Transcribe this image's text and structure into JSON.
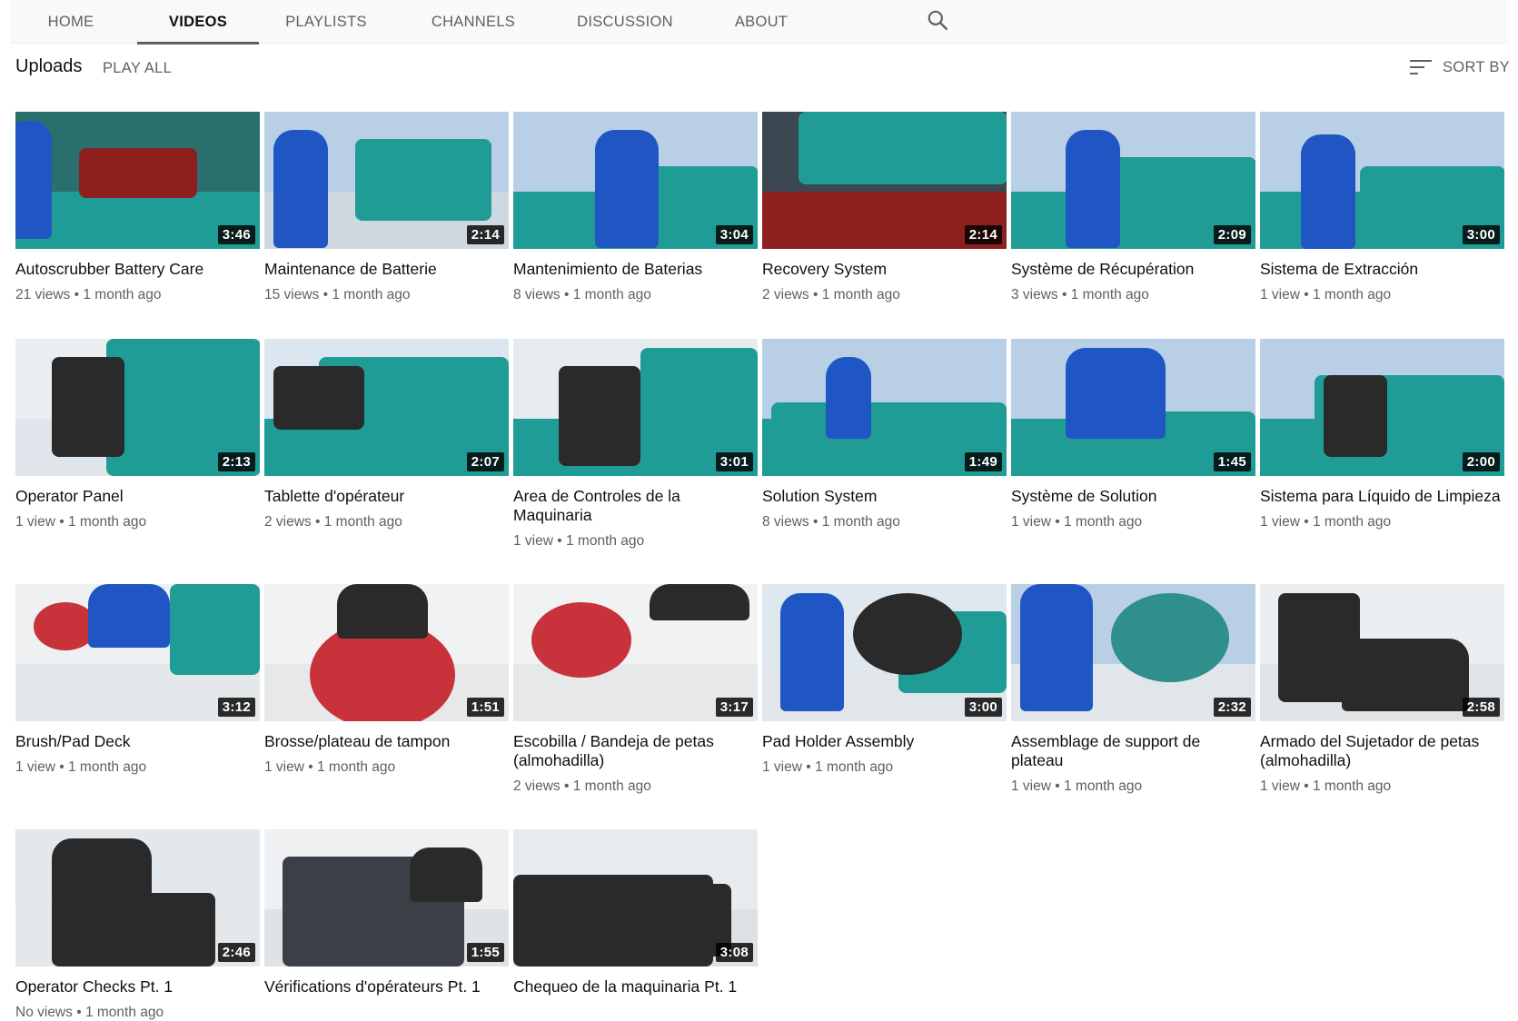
{
  "nav": {
    "tabs": [
      {
        "label": "HOME"
      },
      {
        "label": "VIDEOS"
      },
      {
        "label": "PLAYLISTS"
      },
      {
        "label": "CHANNELS"
      },
      {
        "label": "DISCUSSION"
      },
      {
        "label": "ABOUT"
      }
    ],
    "active_tab": "VIDEOS",
    "search_icon": "search-icon"
  },
  "section": {
    "title": "Uploads",
    "play_all": "PLAY ALL",
    "sort_label": "SORT BY",
    "sort_icon": "sort-icon"
  },
  "videos": [
    {
      "title": "Autoscrubber Battery Care",
      "duration": "3:46",
      "views": "21 views",
      "age": "1 month ago"
    },
    {
      "title": "Maintenance de Batterie",
      "duration": "2:14",
      "views": "15 views",
      "age": "1 month ago"
    },
    {
      "title": "Mantenimiento de Baterias",
      "duration": "3:04",
      "views": "8 views",
      "age": "1 month ago"
    },
    {
      "title": "Recovery System",
      "duration": "2:14",
      "views": "2 views",
      "age": "1 month ago"
    },
    {
      "title": "Système de Récupération",
      "duration": "2:09",
      "views": "3 views",
      "age": "1 month ago"
    },
    {
      "title": "Sistema de Extracción",
      "duration": "3:00",
      "views": "1 view",
      "age": "1 month ago"
    },
    {
      "title": "Operator Panel",
      "duration": "2:13",
      "views": "1 view",
      "age": "1 month ago"
    },
    {
      "title": "Tablette d'opérateur",
      "duration": "2:07",
      "views": "2 views",
      "age": "1 month ago"
    },
    {
      "title": "Area de Controles de la Maquinaria",
      "duration": "3:01",
      "views": "1 view",
      "age": "1 month ago"
    },
    {
      "title": "Solution System",
      "duration": "1:49",
      "views": "8 views",
      "age": "1 month ago"
    },
    {
      "title": "Système de Solution",
      "duration": "1:45",
      "views": "1 view",
      "age": "1 month ago"
    },
    {
      "title": "Sistema para Líquido de Limpieza",
      "duration": "2:00",
      "views": "1 view",
      "age": "1 month ago"
    },
    {
      "title": "Brush/Pad Deck",
      "duration": "3:12",
      "views": "1 view",
      "age": "1 month ago"
    },
    {
      "title": "Brosse/plateau de tampon",
      "duration": "1:51",
      "views": "1 view",
      "age": "1 month ago"
    },
    {
      "title": "Escobilla / Bandeja de petas (almohadilla)",
      "duration": "3:17",
      "views": "2 views",
      "age": "1 month ago"
    },
    {
      "title": "Pad Holder Assembly",
      "duration": "3:00",
      "views": "1 view",
      "age": "1 month ago"
    },
    {
      "title": "Assemblage de support de plateau",
      "duration": "2:32",
      "views": "1 view",
      "age": "1 month ago"
    },
    {
      "title": "Armado del Sujetador de petas (almohadilla)",
      "duration": "2:58",
      "views": "1 view",
      "age": "1 month ago"
    },
    {
      "title": "Operator Checks Pt. 1",
      "duration": "2:46",
      "views": "No views",
      "age": "1 month ago"
    },
    {
      "title": "Vérifications d'opérateurs Pt. 1",
      "duration": "1:55",
      "views": "",
      "age": ""
    },
    {
      "title": "Chequeo de la maquinaria Pt. 1",
      "duration": "3:08",
      "views": "",
      "age": ""
    }
  ],
  "colors": {
    "machine_teal": "#1f9c95",
    "shirt_blue": "#1f56c4",
    "battery_red": "#8e1f1f",
    "floor": "#e8ecef",
    "banner": "#b9cfe6",
    "pad_red": "#c8323a",
    "dark": "#2a2a2a"
  }
}
